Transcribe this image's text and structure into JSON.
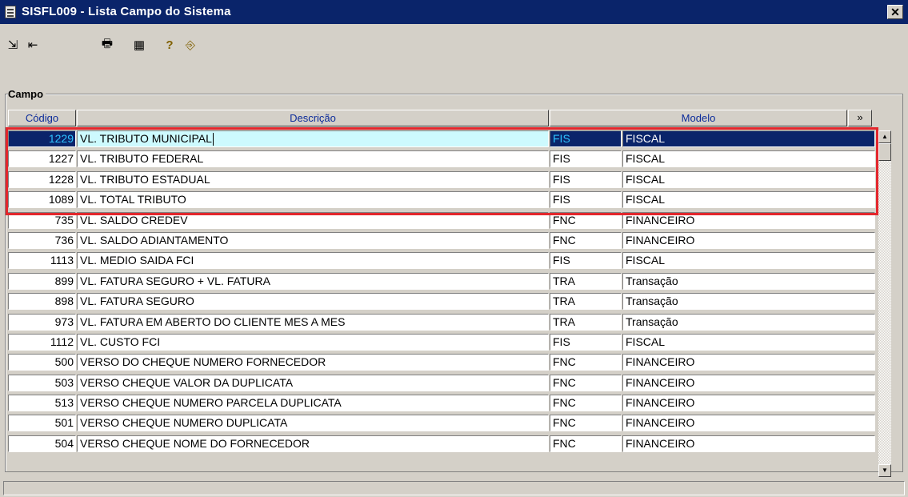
{
  "window": {
    "title": "SISFL009 - Lista Campo do Sistema",
    "close_glyph": "✕"
  },
  "toolbar": [
    {
      "name": "go-first-icon",
      "glyph": "⇲"
    },
    {
      "name": "go-back-icon",
      "glyph": "⇤"
    },
    {
      "name": "print-icon",
      "glyph": "🖶"
    },
    {
      "name": "calendar-grid-icon",
      "glyph": "▦"
    },
    {
      "name": "help-icon",
      "glyph": "?"
    },
    {
      "name": "exit-door-icon",
      "glyph": "⎆"
    }
  ],
  "section": {
    "label": "Campo"
  },
  "columns": {
    "codigo": "Código",
    "descricao": "Descrição",
    "modelo": "Modelo",
    "more": "»"
  },
  "rows": [
    {
      "codigo": "1229",
      "descricao": "VL. TRIBUTO MUNICIPAL",
      "modelo": "FIS",
      "modelo_nome": "FISCAL",
      "selected": true
    },
    {
      "codigo": "1227",
      "descricao": "VL. TRIBUTO FEDERAL",
      "modelo": "FIS",
      "modelo_nome": "FISCAL"
    },
    {
      "codigo": "1228",
      "descricao": "VL. TRIBUTO ESTADUAL",
      "modelo": "FIS",
      "modelo_nome": "FISCAL"
    },
    {
      "codigo": "1089",
      "descricao": "VL. TOTAL TRIBUTO",
      "modelo": "FIS",
      "modelo_nome": "FISCAL"
    },
    {
      "codigo": "735",
      "descricao": "VL. SALDO CREDEV",
      "modelo": "FNC",
      "modelo_nome": "FINANCEIRO"
    },
    {
      "codigo": "736",
      "descricao": "VL. SALDO ADIANTAMENTO",
      "modelo": "FNC",
      "modelo_nome": "FINANCEIRO"
    },
    {
      "codigo": "1113",
      "descricao": "VL. MEDIO SAIDA FCI",
      "modelo": "FIS",
      "modelo_nome": "FISCAL"
    },
    {
      "codigo": "899",
      "descricao": "VL. FATURA SEGURO + VL. FATURA",
      "modelo": "TRA",
      "modelo_nome": "Transação"
    },
    {
      "codigo": "898",
      "descricao": "VL. FATURA SEGURO",
      "modelo": "TRA",
      "modelo_nome": "Transação"
    },
    {
      "codigo": "973",
      "descricao": "VL. FATURA EM ABERTO DO CLIENTE MES A MES",
      "modelo": "TRA",
      "modelo_nome": "Transação"
    },
    {
      "codigo": "1112",
      "descricao": "VL. CUSTO FCI",
      "modelo": "FIS",
      "modelo_nome": "FISCAL"
    },
    {
      "codigo": "500",
      "descricao": "VERSO DO CHEQUE NUMERO FORNECEDOR",
      "modelo": "FNC",
      "modelo_nome": "FINANCEIRO"
    },
    {
      "codigo": "503",
      "descricao": "VERSO CHEQUE VALOR DA DUPLICATA",
      "modelo": "FNC",
      "modelo_nome": "FINANCEIRO"
    },
    {
      "codigo": "513",
      "descricao": "VERSO CHEQUE NUMERO PARCELA DUPLICATA",
      "modelo": "FNC",
      "modelo_nome": "FINANCEIRO"
    },
    {
      "codigo": "501",
      "descricao": "VERSO CHEQUE NUMERO DUPLICATA",
      "modelo": "FNC",
      "modelo_nome": "FINANCEIRO"
    },
    {
      "codigo": "504",
      "descricao": "VERSO CHEQUE NOME DO FORNECEDOR",
      "modelo": "FNC",
      "modelo_nome": "FINANCEIRO"
    }
  ],
  "scrollbar": {
    "up_glyph": "▲",
    "down_glyph": "▼"
  },
  "colors": {
    "title_bar": "#0a246a",
    "header_text": "#0b2b9a",
    "highlight_border": "#e3262c",
    "selected_code": "#2ec2ff",
    "selected_desc_bg": "#cdfafe"
  }
}
